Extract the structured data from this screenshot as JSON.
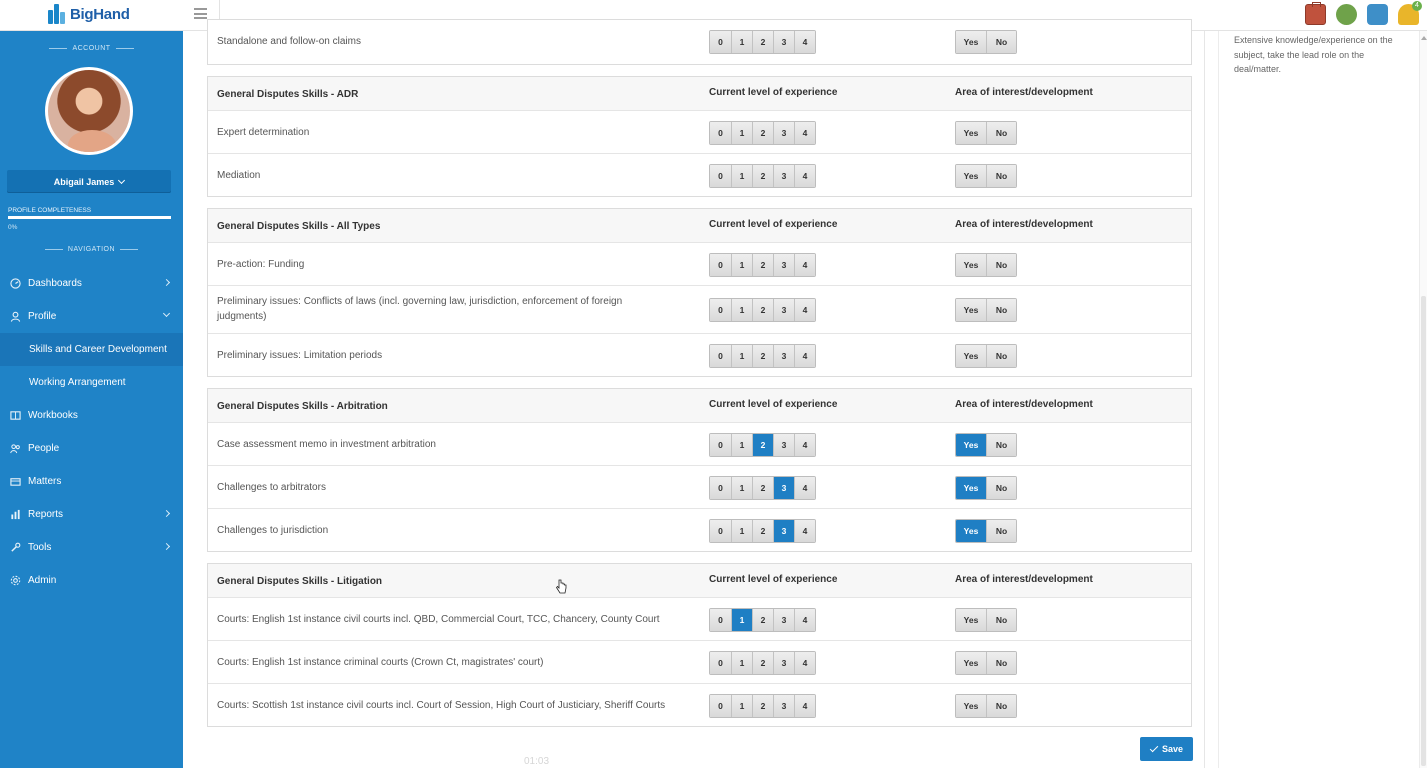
{
  "app": {
    "logo_text": "BigHand",
    "accent": "#1f83c7"
  },
  "sidebar": {
    "account_caption": "ACCOUNT",
    "user_name": "Abigail James",
    "completeness_label": "PROFILE COMPLETENESS",
    "completeness_value": "0%",
    "completeness_fraction": 0.0,
    "navigation_caption": "NAVIGATION",
    "items": [
      {
        "label": "Dashboards",
        "icon": "dashboard-icon"
      },
      {
        "label": "Profile",
        "icon": "user-icon"
      },
      {
        "label": "Skills and Career Development"
      },
      {
        "label": "Working Arrangement"
      },
      {
        "label": "Workbooks",
        "icon": "book-icon"
      },
      {
        "label": "People",
        "icon": "people-icon"
      },
      {
        "label": "Matters",
        "icon": "folder-icon"
      },
      {
        "label": "Reports",
        "icon": "chart-icon"
      },
      {
        "label": "Tools",
        "icon": "wrench-icon"
      },
      {
        "label": "Admin",
        "icon": "gear-icon"
      }
    ]
  },
  "top_icons": {
    "notification_count": "4"
  },
  "table": {
    "col_level": "Current level of experience",
    "col_interest": "Area of interest/development",
    "levels": [
      "0",
      "1",
      "2",
      "3",
      "4"
    ],
    "yes_label": "Yes",
    "no_label": "No",
    "sections": [
      {
        "title": "",
        "rows": [
          {
            "label": "Standalone and follow-on claims",
            "level": null,
            "interest": null
          }
        ]
      },
      {
        "title": "General Disputes Skills - ADR",
        "rows": [
          {
            "label": "Expert determination",
            "level": null,
            "interest": null
          },
          {
            "label": "Mediation",
            "level": null,
            "interest": null
          }
        ]
      },
      {
        "title": "General Disputes Skills - All Types",
        "rows": [
          {
            "label": "Pre-action: Funding",
            "level": null,
            "interest": null
          },
          {
            "label": "Preliminary issues: Conflicts of laws (incl. governing law, jurisdiction, enforcement of foreign judgments)",
            "level": null,
            "interest": null
          },
          {
            "label": "Preliminary issues: Limitation periods",
            "level": null,
            "interest": null
          }
        ]
      },
      {
        "title": "General Disputes Skills - Arbitration",
        "rows": [
          {
            "label": "Case assessment memo in investment arbitration",
            "level": "2",
            "interest": "Yes"
          },
          {
            "label": "Challenges to arbitrators",
            "level": "3",
            "interest": "Yes"
          },
          {
            "label": "Challenges to jurisdiction",
            "level": "3",
            "interest": "Yes"
          }
        ]
      },
      {
        "title": "General Disputes Skills - Litigation",
        "rows": [
          {
            "label": "Courts: English 1st instance civil courts incl. QBD, Commercial Court, TCC, Chancery, County Court",
            "level": "1",
            "interest": null
          },
          {
            "label": "Courts: English 1st instance criminal courts (Crown Ct, magistrates' court)",
            "level": null,
            "interest": null
          },
          {
            "label": "Courts: Scottish 1st instance civil courts incl. Court of Session, High Court of Justiciary, Sheriff Courts",
            "level": null,
            "interest": null
          }
        ]
      }
    ]
  },
  "save_label": "Save",
  "timer": "01:03",
  "right_panel": {
    "text": "Extensive knowledge/experience on the subject, take the lead role on the deal/matter."
  }
}
